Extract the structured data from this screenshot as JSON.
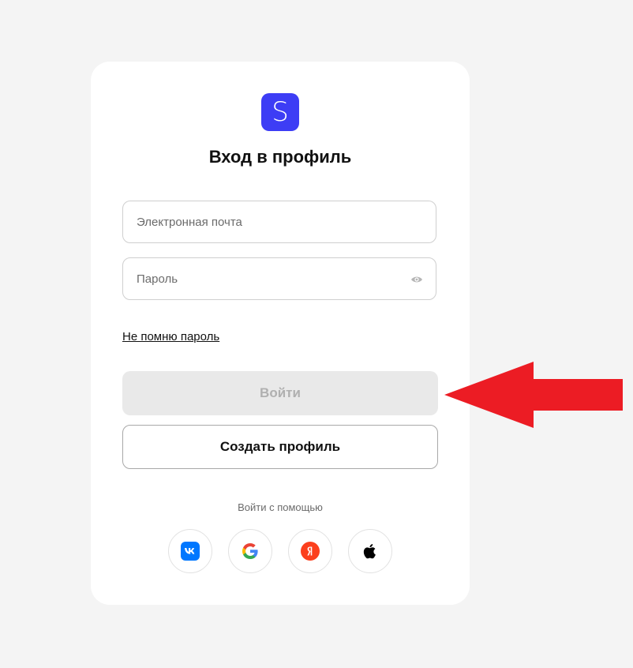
{
  "logo": {
    "letter": "S",
    "color": "#3d3df5"
  },
  "title": "Вход в профиль",
  "email_field": {
    "placeholder": "Электронная почта",
    "value": ""
  },
  "password_field": {
    "placeholder": "Пароль",
    "value": "",
    "icon": "eye-icon"
  },
  "forgot_link": "Не помню пароль",
  "login_button": {
    "label": "Войти",
    "state": "disabled"
  },
  "create_button": {
    "label": "Создать профиль"
  },
  "social": {
    "label": "Войти с помощью",
    "providers": [
      {
        "name": "vk",
        "icon": "vk-icon",
        "color": "#0077ff"
      },
      {
        "name": "google",
        "icon": "google-icon",
        "color": "#4285f4"
      },
      {
        "name": "yandex",
        "icon": "yandex-icon",
        "color": "#fc3f1d"
      },
      {
        "name": "apple",
        "icon": "apple-icon",
        "color": "#000000"
      }
    ]
  },
  "annotation": {
    "icon": "red-arrow-icon",
    "color": "#ec1c24"
  }
}
